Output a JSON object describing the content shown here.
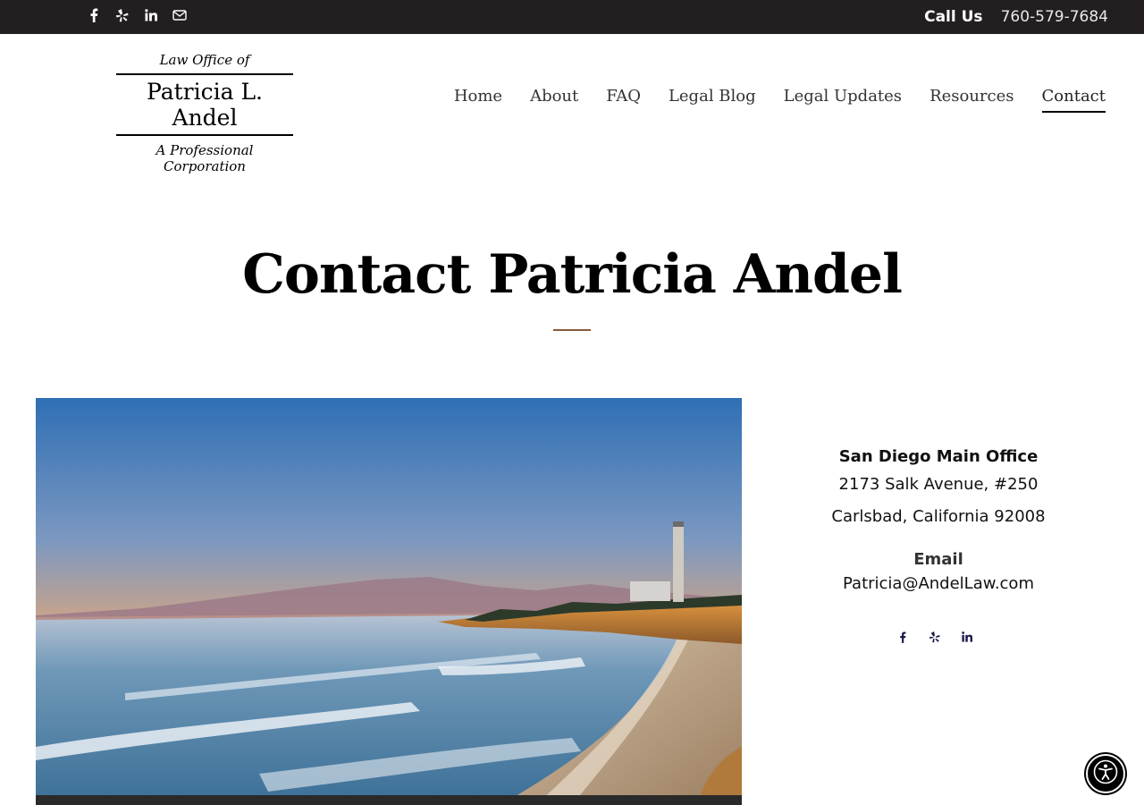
{
  "topbar": {
    "social_icons": [
      "facebook-icon",
      "yelp-icon",
      "linkedin-icon",
      "email-icon"
    ],
    "call_label": "Call Us",
    "phone": "760-579-7684"
  },
  "logo": {
    "line1": "Law Office of",
    "line2": "Patricia L. Andel",
    "line3": "A Professional Corporation"
  },
  "nav": {
    "items": [
      {
        "label": "Home"
      },
      {
        "label": "About"
      },
      {
        "label": "FAQ"
      },
      {
        "label": "Legal Blog"
      },
      {
        "label": "Legal Updates"
      },
      {
        "label": "Resources"
      },
      {
        "label": "Contact",
        "active": true
      }
    ]
  },
  "page": {
    "title": "Contact Patricia Andel"
  },
  "contact": {
    "office_name": "San Diego Main Office",
    "address_line1": "2173 Salk Avenue, #250",
    "address_line2": "Carlsbad, California 92008",
    "email_label": "Email",
    "email": "Patricia@AndelLaw.com",
    "social_icons": [
      "facebook-icon",
      "yelp-icon",
      "linkedin-icon"
    ]
  },
  "colors": {
    "topbar_bg": "#231f20",
    "accent_rule": "#8a5a3c",
    "social_icon_dark": "#1a1a4a"
  }
}
